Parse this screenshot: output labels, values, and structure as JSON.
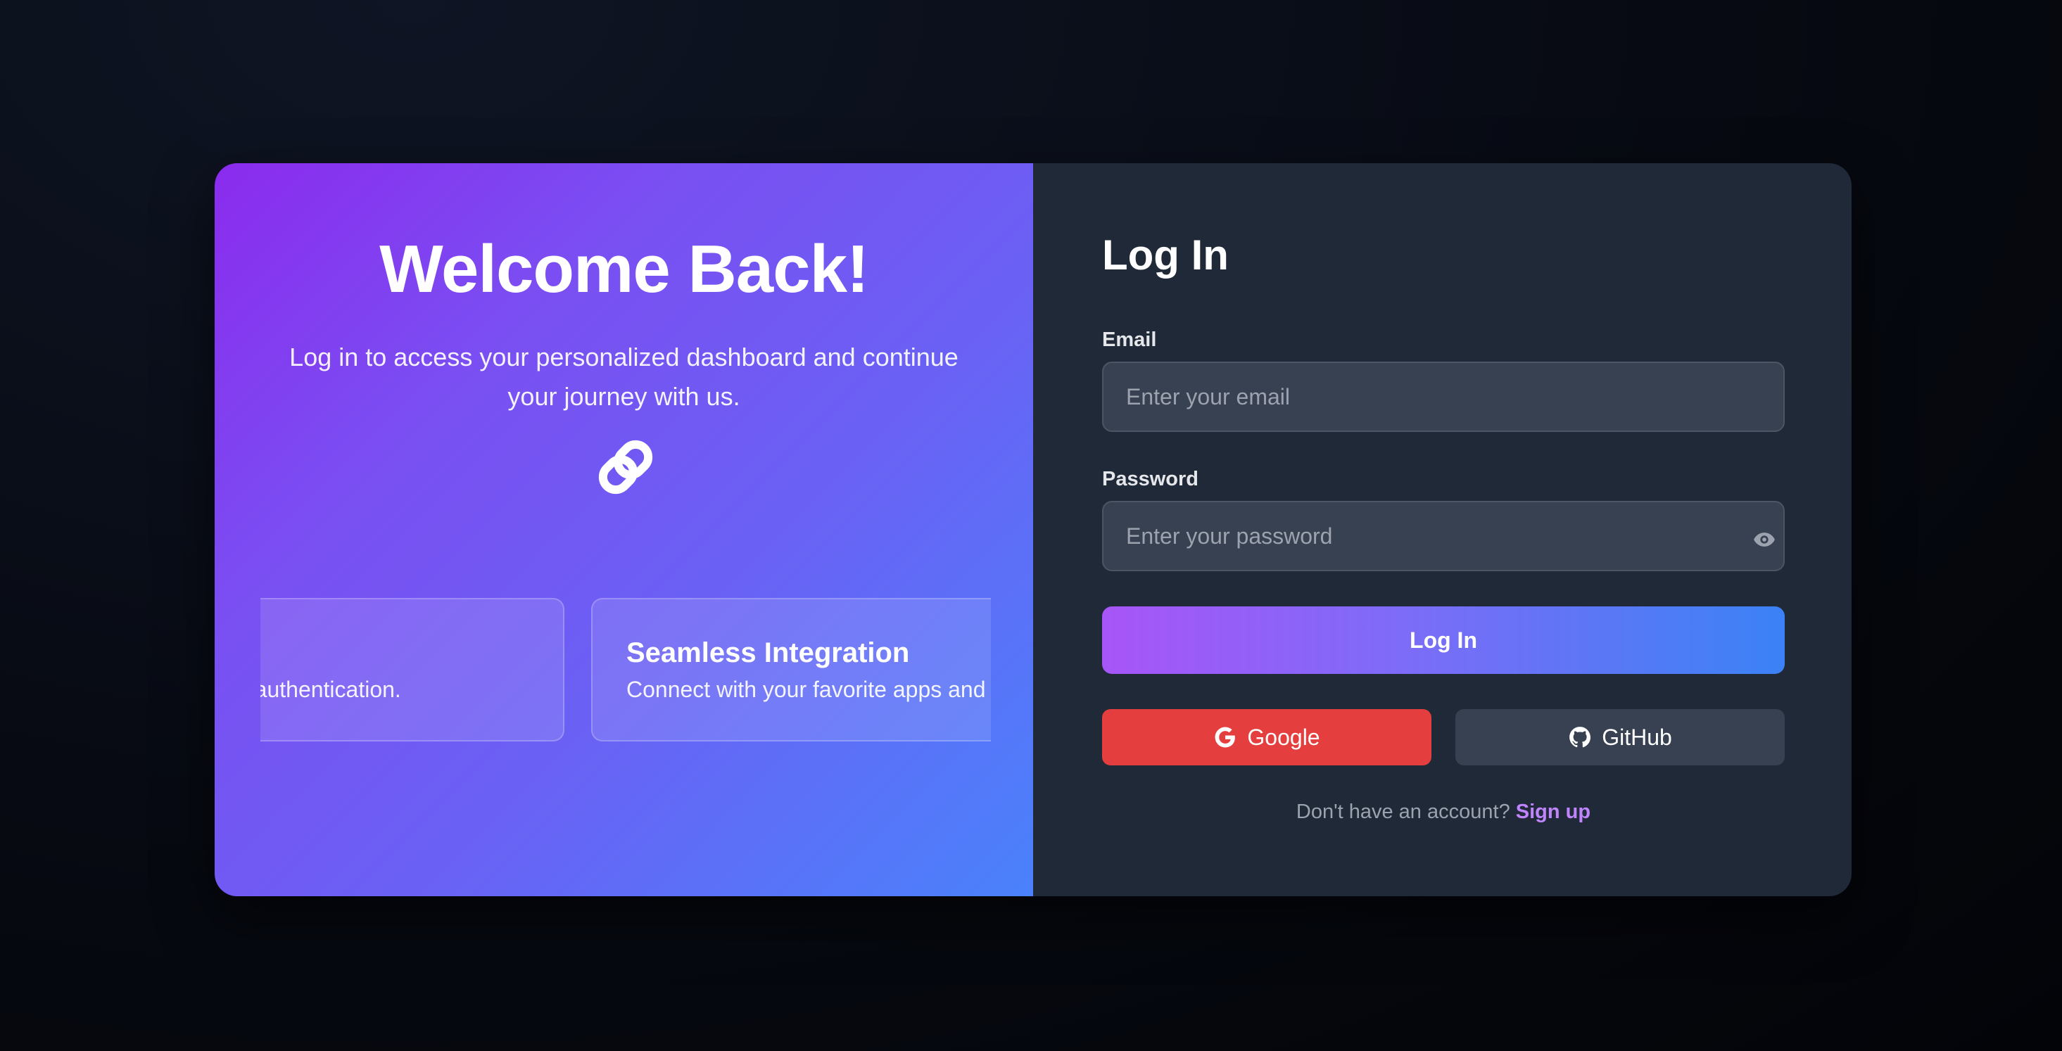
{
  "left_panel": {
    "title": "Welcome Back!",
    "subtitle": "Log in to access your personalized dashboard and continue your journey with us.",
    "icon": "link-icon",
    "features": [
      {
        "title": "",
        "description": "authentication."
      },
      {
        "title": "Seamless Integration",
        "description": "Connect with your favorite apps and"
      }
    ]
  },
  "login_form": {
    "title": "Log In",
    "email": {
      "label": "Email",
      "placeholder": "Enter your email",
      "value": ""
    },
    "password": {
      "label": "Password",
      "placeholder": "Enter your password",
      "value": "",
      "toggle_icon": "eye-icon"
    },
    "submit_label": "Log In",
    "social": {
      "google_label": "Google",
      "google_icon": "google-icon",
      "github_label": "GitHub",
      "github_icon": "github-icon"
    },
    "signup": {
      "prompt": "Don't have an account?",
      "link_label": "Sign up"
    }
  },
  "colors": {
    "gradient_start": "#8b2bee",
    "gradient_end": "#4a82fb",
    "panel_bg": "#1f2937",
    "input_bg": "#374151",
    "google_red": "#e53e3e",
    "github_gray": "#374151",
    "link_purple": "#c084fc"
  }
}
